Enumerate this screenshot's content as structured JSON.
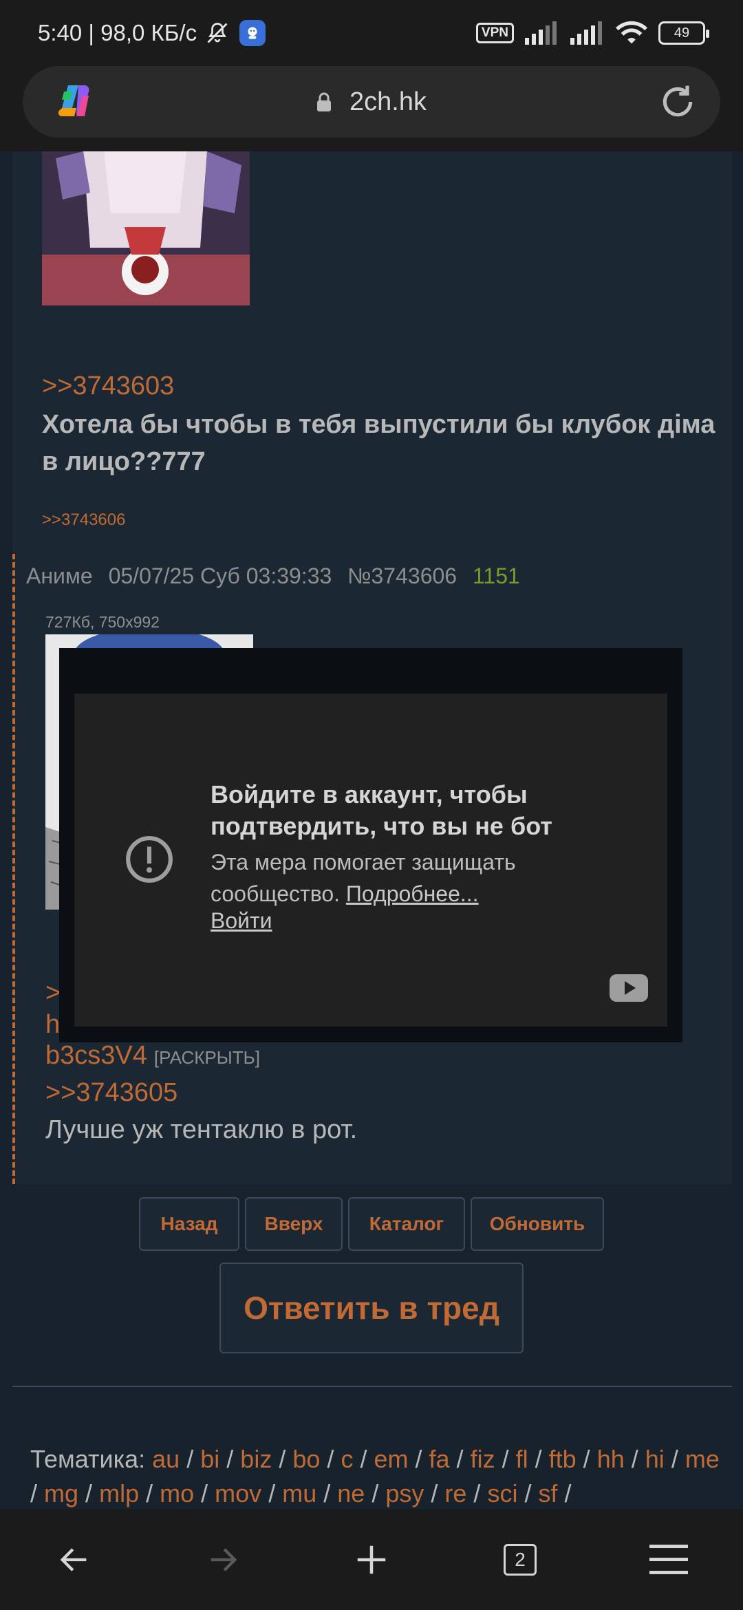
{
  "status_bar": {
    "time_speed": "5:40 | 98,0 КБ/с",
    "vpn": "VPN",
    "battery": "49"
  },
  "url_bar": {
    "url": "2ch.hk"
  },
  "post_top": {
    "reply_ref": ">>3743603",
    "text": "Хотела бы чтобы в тебя выпустили бы клубок діма в лицо??777",
    "backref": ">>3743606"
  },
  "post2": {
    "name": "Аниме",
    "date": "05/07/25 Суб 03:39:33",
    "number": "№3743606",
    "count": "1151",
    "file_info": "727Кб, 750x992",
    "link_frag_1": ">",
    "link_frag_2": "h",
    "short_link": "b3cs3V4",
    "expand": "[РАСКРЫТЬ]",
    "reply_ref": ">>3743605",
    "body": "Лучше уж тентаклю в рот."
  },
  "embed": {
    "title": "Войдите в аккаунт, чтобы подтвердить, что вы не бот",
    "text": "Эта мера помогает защищать сообщество.",
    "more_link": "Подробнее...",
    "login": "Войти"
  },
  "buttons": {
    "back": "Назад",
    "up": "Вверх",
    "catalog": "Каталог",
    "refresh": "Обновить",
    "reply": "Ответить в тред"
  },
  "tags": {
    "label": "Тематика:",
    "items": [
      "au",
      "bi",
      "biz",
      "bo",
      "c",
      "em",
      "fa",
      "fiz",
      "fl",
      "ftb",
      "hh",
      "hi",
      "me",
      "mg",
      "mlp",
      "mo",
      "mov",
      "mu",
      "ne",
      "psy",
      "re",
      "sci",
      "sf"
    ]
  },
  "bottom_nav": {
    "tabs_count": "2"
  },
  "colors": {
    "accent": "#c06a35",
    "background": "#17222d",
    "post_bg": "#1c2734"
  }
}
